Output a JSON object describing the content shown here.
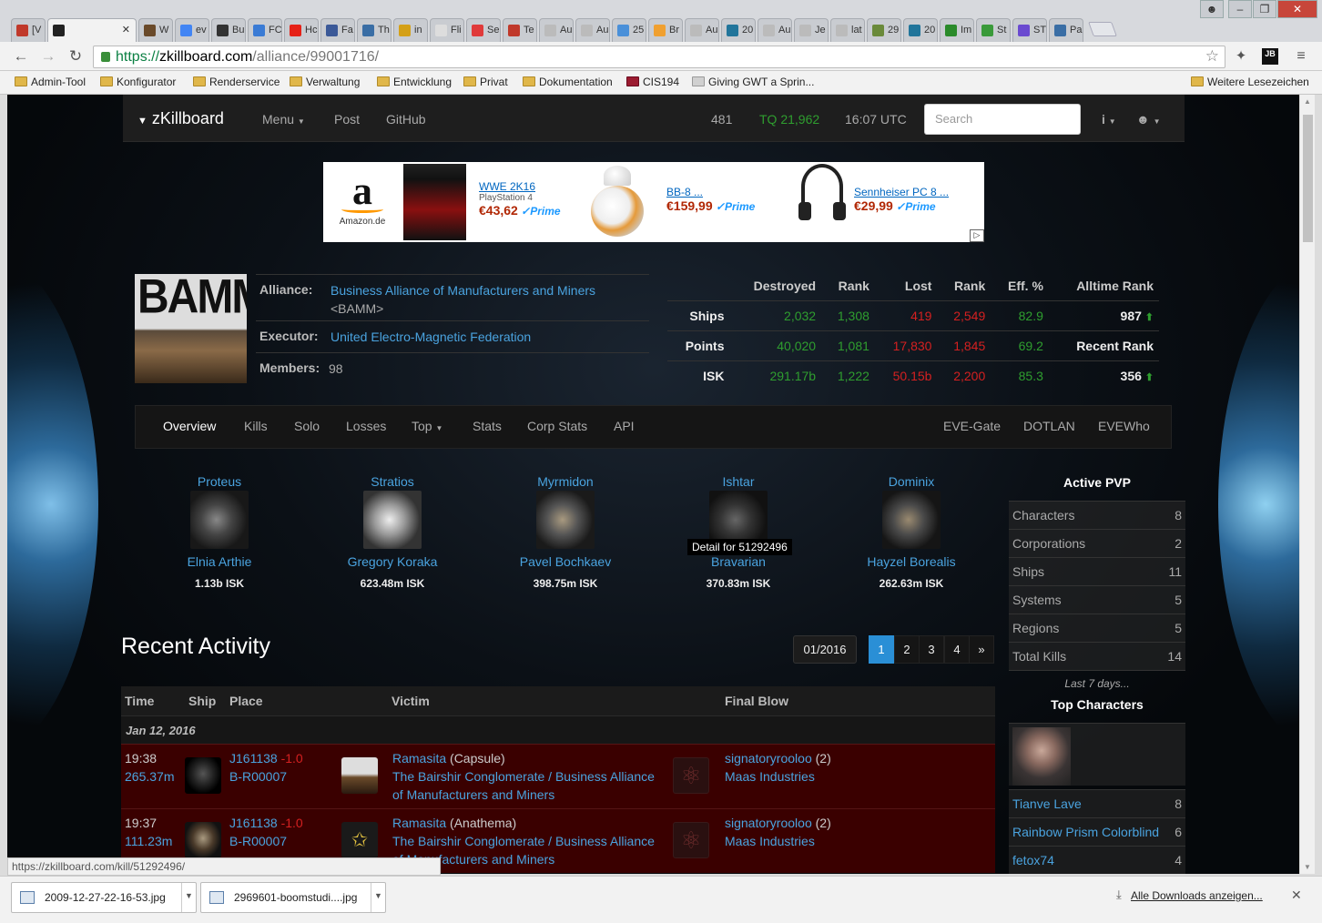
{
  "browser": {
    "tabs": [
      {
        "label": "[V",
        "color": "#c0392b"
      },
      {
        "label": "",
        "color": "#222"
      },
      {
        "label": "W",
        "color": "#6a4a2a"
      },
      {
        "label": "ev",
        "color": "#4285f4"
      },
      {
        "label": "Bu",
        "color": "#333"
      },
      {
        "label": "FC",
        "color": "#3a7bd5"
      },
      {
        "label": "Hc",
        "color": "#e62117"
      },
      {
        "label": "Fa",
        "color": "#3b5998"
      },
      {
        "label": "Th",
        "color": "#3a6ea5"
      },
      {
        "label": "in",
        "color": "#d4a017"
      },
      {
        "label": "Fli",
        "color": "#ddd"
      },
      {
        "label": "Se",
        "color": "#e03a3a"
      },
      {
        "label": "Te",
        "color": "#c0392b"
      },
      {
        "label": "Au",
        "color": "#bbb"
      },
      {
        "label": "Au",
        "color": "#bbb"
      },
      {
        "label": "25",
        "color": "#4a90d9"
      },
      {
        "label": "Br",
        "color": "#f0a030"
      },
      {
        "label": "Au",
        "color": "#bbb"
      },
      {
        "label": "20",
        "color": "#21759b"
      },
      {
        "label": "Au",
        "color": "#bbb"
      },
      {
        "label": "Je",
        "color": "#bbb"
      },
      {
        "label": "lat",
        "color": "#bbb"
      },
      {
        "label": "29",
        "color": "#6a8a3a"
      },
      {
        "label": "20",
        "color": "#21759b"
      },
      {
        "label": "Im",
        "color": "#2a8a2a"
      },
      {
        "label": "St",
        "color": "#3a9a3a"
      },
      {
        "label": "ST",
        "color": "#6a4ad0"
      },
      {
        "label": "Pa",
        "color": "#3a6ea5"
      }
    ],
    "url_scheme": "https://",
    "url_host": "zkillboard.com",
    "url_path": "/alliance/99001716/",
    "bookmarks": [
      "Admin-Tool",
      "Konfigurator",
      "Renderservice",
      "Verwaltung",
      "Entwicklung",
      "Privat",
      "Dokumentation",
      "CIS194",
      "Giving GWT a Sprin..."
    ],
    "bookmarks_other": "Weitere Lesezeichen",
    "status_url": "https://zkillboard.com/kill/51292496/",
    "downloads": [
      "2009-12-27-22-16-53.jpg",
      "2969601-boomstudi....jpg"
    ],
    "all_downloads": "Alle Downloads anzeigen..."
  },
  "navbar": {
    "brand": "zKillboard",
    "menu": "Menu",
    "post": "Post",
    "github": "GitHub",
    "count": "481",
    "tq": "TQ 21,962",
    "time": "16:07 UTC",
    "search_placeholder": "Search"
  },
  "ad": {
    "brand": "Amazon.de",
    "items": [
      {
        "title": "WWE 2K16",
        "sub": "PlayStation 4",
        "price": "€43,62",
        "prime": "✓Prime"
      },
      {
        "title": "BB-8 ...",
        "sub": "",
        "price": "€159,99",
        "prime": "✓Prime"
      },
      {
        "title": "Sennheiser PC 8 ...",
        "sub": "",
        "price": "€29,99",
        "prime": "✓Prime"
      }
    ]
  },
  "alliance": {
    "logo_text": "BAMM",
    "alliance_label": "Alliance:",
    "alliance_name": "Business Alliance of Manufacturers and Miners",
    "ticker": "<BAMM>",
    "executor_label": "Executor:",
    "executor": "United Electro-Magnetic Federation",
    "members_label": "Members:",
    "members": "98"
  },
  "stats": {
    "headers": [
      "Destroyed",
      "Rank",
      "Lost",
      "Rank",
      "Eff. %",
      "Alltime Rank"
    ],
    "rows": [
      {
        "label": "Ships",
        "destroyed": "2,032",
        "drank": "1,308",
        "lost": "419",
        "lrank": "2,549",
        "eff": "82.9",
        "extra": "987"
      },
      {
        "label": "Points",
        "destroyed": "40,020",
        "drank": "1,081",
        "lost": "17,830",
        "lrank": "1,845",
        "eff": "69.2",
        "extra": "Recent Rank"
      },
      {
        "label": "ISK",
        "destroyed": "291.17b",
        "drank": "1,222",
        "lost": "50.15b",
        "lrank": "2,200",
        "eff": "85.3",
        "extra": "356"
      }
    ]
  },
  "subnav": {
    "left": [
      "Overview",
      "Kills",
      "Solo",
      "Losses",
      "Top",
      "Stats",
      "Corp Stats",
      "API"
    ],
    "right": [
      "EVE-Gate",
      "DOTLAN",
      "EVEWho"
    ]
  },
  "top_kills": [
    {
      "ship": "Proteus",
      "pilot": "Elnia Arthie",
      "isk": "1.13b ISK"
    },
    {
      "ship": "Stratios",
      "pilot": "Gregory Koraka",
      "isk": "623.48m ISK"
    },
    {
      "ship": "Myrmidon",
      "pilot": "Pavel Bochkaev",
      "isk": "398.75m ISK"
    },
    {
      "ship": "Ishtar",
      "pilot": "Bravarian",
      "isk": "370.83m ISK"
    },
    {
      "ship": "Dominix",
      "pilot": "Hayzel Borealis",
      "isk": "262.63m ISK"
    }
  ],
  "tooltip": "Detail for 51292496",
  "active_pvp": {
    "title": "Active PVP",
    "rows": [
      {
        "label": "Characters",
        "n": "8"
      },
      {
        "label": "Corporations",
        "n": "2"
      },
      {
        "label": "Ships",
        "n": "11"
      },
      {
        "label": "Systems",
        "n": "5"
      },
      {
        "label": "Regions",
        "n": "5"
      },
      {
        "label": "Total Kills",
        "n": "14"
      }
    ],
    "note": "Last 7 days..."
  },
  "top_characters": {
    "title": "Top Characters",
    "rows": [
      {
        "label": "Tianve Lave",
        "n": "8"
      },
      {
        "label": "Rainbow Prism Colorblind",
        "n": "6"
      },
      {
        "label": "fetox74",
        "n": "4"
      }
    ]
  },
  "recent": {
    "title": "Recent Activity",
    "month": "01/2016",
    "pages": [
      "1",
      "2",
      "3",
      "4",
      "»"
    ],
    "headers": [
      "Time",
      "Ship",
      "Place",
      "Victim",
      "Final Blow"
    ],
    "date": "Jan 12, 2016",
    "rows": [
      {
        "time": "19:38",
        "isk": "265.37m",
        "system": "J161138",
        "sec": "-1.0",
        "region": "B-R00007",
        "victim": "Ramasita",
        "vship": "(Capsule)",
        "vorg": "The Bairshir Conglomerate / Business Alliance of Manufacturers and Miners",
        "fb": "signatoryrooloo",
        "fbn": "(2)",
        "fbcorp": "Maas Industries"
      },
      {
        "time": "19:37",
        "isk": "111.23m",
        "system": "J161138",
        "sec": "-1.0",
        "region": "B-R00007",
        "victim": "Ramasita",
        "vship": "(Anathema)",
        "vorg": "The Bairshir Conglomerate / Business Alliance of Manufacturers and Miners",
        "fb": "signatoryrooloo",
        "fbn": "(2)",
        "fbcorp": "Maas Industries"
      }
    ]
  }
}
